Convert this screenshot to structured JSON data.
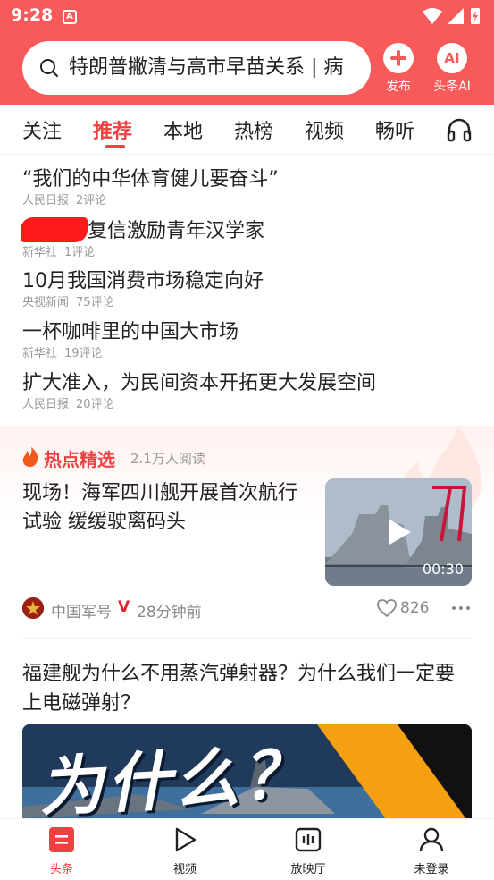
{
  "status_bar": {
    "time": "9:28",
    "app_icon_letter": "A"
  },
  "search": {
    "query": "特朗普撇清与高市早苗关系 | 病"
  },
  "header_buttons": {
    "publish": {
      "label": "发布",
      "icon": "plus-icon"
    },
    "ai": {
      "label": "头条AI",
      "badge": "AI"
    }
  },
  "tabs": [
    {
      "label": "关注",
      "active": false
    },
    {
      "label": "推荐",
      "active": true
    },
    {
      "label": "本地",
      "active": false
    },
    {
      "label": "热榜",
      "active": false
    },
    {
      "label": "视频",
      "active": false
    },
    {
      "label": "畅听",
      "active": false
    }
  ],
  "headlines": [
    {
      "title": "“我们的中华体育健儿要奋斗”",
      "source": "人民日报",
      "comments": "2评论"
    },
    {
      "title": "复信激励青年汉学家",
      "redacted_prefix": true,
      "source": "新华社",
      "comments": "1评论"
    },
    {
      "title": "10月我国消费市场稳定向好",
      "source": "央视新闻",
      "comments": "75评论"
    },
    {
      "title": "一杯咖啡里的中国大市场",
      "source": "新华社",
      "comments": "19评论"
    },
    {
      "title": "扩大准入，为民间资本开拓更大发展空间",
      "source": "人民日报",
      "comments": "20评论"
    }
  ],
  "hot_pick": {
    "label": "热点精选",
    "reads": "2.1万人阅读",
    "title": "现场！海军四川舰开展首次航行试验 缓缓驶离码头",
    "duration": "00:30",
    "source": "中国军号",
    "verified_mark": "V",
    "time_ago": "28分钟前",
    "likes": "826"
  },
  "article": {
    "title": "福建舰为什么不用蒸汽弹射器？为什么我们一定要上电磁弹射？",
    "image_text": "为什么？"
  },
  "bottom_nav": [
    {
      "label": "头条",
      "icon": "news-icon",
      "active": true
    },
    {
      "label": "视频",
      "icon": "play-icon",
      "active": false
    },
    {
      "label": "放映厅",
      "icon": "theater-icon",
      "active": false
    },
    {
      "label": "未登录",
      "icon": "user-icon",
      "active": false
    }
  ],
  "colors": {
    "brand": "#f85959",
    "accent": "#f04142",
    "muted": "#999999"
  }
}
